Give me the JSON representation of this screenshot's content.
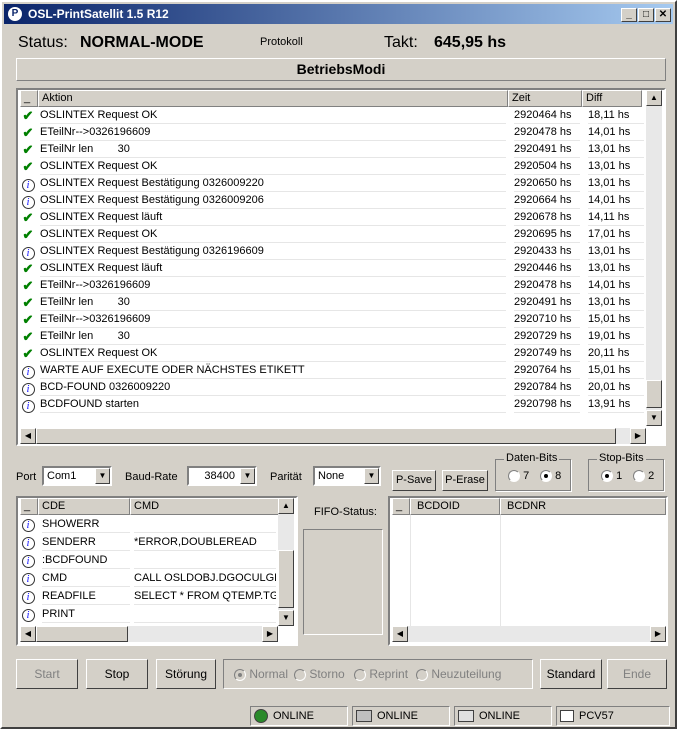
{
  "window": {
    "title": "OSL-PrintSatellit 1.5 R12",
    "app_icon": "P",
    "min": "_",
    "max": "□",
    "close": "✕"
  },
  "top": {
    "status_label": "Status:",
    "status_value": "NORMAL-MODE",
    "protokoll": "Protokoll",
    "takt_label": "Takt:",
    "takt_value": "645,95 hs"
  },
  "mode_title": "BetriebsModi",
  "log": {
    "headers": [
      "_",
      "Aktion",
      "Zeit",
      "Diff"
    ],
    "rows": [
      {
        "icon": "check",
        "aktion": "OSLINTEX Request OK",
        "zeit": "2920464 hs",
        "diff": "18,11 hs"
      },
      {
        "icon": "check",
        "aktion": "ETeilNr-->0326196609",
        "zeit": "2920478 hs",
        "diff": "14,01 hs"
      },
      {
        "icon": "check",
        "aktion": "ETeilNr len        30",
        "zeit": "2920491 hs",
        "diff": "13,01 hs"
      },
      {
        "icon": "check",
        "aktion": "OSLINTEX Request OK",
        "zeit": "2920504 hs",
        "diff": "13,01 hs"
      },
      {
        "icon": "info",
        "aktion": "OSLINTEX Request Bestätigung 0326009220",
        "zeit": "2920650 hs",
        "diff": "13,01 hs"
      },
      {
        "icon": "info",
        "aktion": "OSLINTEX Request Bestätigung 0326009206",
        "zeit": "2920664 hs",
        "diff": "14,01 hs"
      },
      {
        "icon": "check",
        "aktion": "OSLINTEX Request läuft",
        "zeit": "2920678 hs",
        "diff": "14,11 hs"
      },
      {
        "icon": "check",
        "aktion": "OSLINTEX Request OK",
        "zeit": "2920695 hs",
        "diff": "17,01 hs"
      },
      {
        "icon": "info",
        "aktion": "OSLINTEX Request Bestätigung 0326196609",
        "zeit": "2920433 hs",
        "diff": "13,01 hs"
      },
      {
        "icon": "check",
        "aktion": "OSLINTEX Request läuft",
        "zeit": "2920446 hs",
        "diff": "13,01 hs"
      },
      {
        "icon": "check",
        "aktion": "ETeilNr-->0326196609",
        "zeit": "2920478 hs",
        "diff": "14,01 hs"
      },
      {
        "icon": "check",
        "aktion": "ETeilNr len        30",
        "zeit": "2920491 hs",
        "diff": "13,01 hs"
      },
      {
        "icon": "check",
        "aktion": "ETeilNr-->0326196609",
        "zeit": "2920710 hs",
        "diff": "15,01 hs"
      },
      {
        "icon": "check",
        "aktion": "ETeilNr len        30",
        "zeit": "2920729 hs",
        "diff": "19,01 hs"
      },
      {
        "icon": "check",
        "aktion": "OSLINTEX Request OK",
        "zeit": "2920749 hs",
        "diff": "20,11 hs"
      },
      {
        "icon": "info",
        "aktion": "WARTE AUF EXECUTE ODER NÄCHSTES ETIKETT",
        "zeit": "2920764 hs",
        "diff": "15,01 hs"
      },
      {
        "icon": "info",
        "aktion": "BCD-FOUND 0326009220",
        "zeit": "2920784 hs",
        "diff": "20,01 hs"
      },
      {
        "icon": "info",
        "aktion": "BCDFOUND starten",
        "zeit": "2920798 hs",
        "diff": "13,91 hs"
      }
    ]
  },
  "port": {
    "label": "Port",
    "value": "Com1",
    "baud_label": "Baud-Rate",
    "baud_value": "38400",
    "paritaet_label": "Parität",
    "paritaet_value": "None"
  },
  "buttons": {
    "psave": "P-Save",
    "perase": "P-Erase",
    "start": "Start",
    "stop": "Stop",
    "stoerung": "Störung",
    "standard": "Standard",
    "ende": "Ende"
  },
  "databits": {
    "title": "Daten-Bits",
    "opt1": "7",
    "opt2": "8"
  },
  "stopbits": {
    "title": "Stop-Bits",
    "opt1": "1",
    "opt2": "2"
  },
  "cmd": {
    "headers": [
      "_",
      "CDE",
      "CMD"
    ],
    "rows": [
      {
        "cde": "SHOWERR",
        "cmd": ""
      },
      {
        "cde": "SENDERR",
        "cmd": "*ERROR,DOUBLEREAD"
      },
      {
        "cde": ":BCDFOUND",
        "cmd": ""
      },
      {
        "cde": "CMD",
        "cmd": "CALL OSLDOBJ.DGOCULGP"
      },
      {
        "cde": "READFILE",
        "cmd": "SELECT * FROM QTEMP.TGO"
      },
      {
        "cde": "PRINT",
        "cmd": ""
      }
    ]
  },
  "fifo": {
    "label": "FIFO-Status:"
  },
  "bcd": {
    "headers": [
      "_",
      "BCDOID",
      "BCDNR"
    ]
  },
  "modes": {
    "normal": "Normal",
    "storno": "Storno",
    "reprint": "Reprint",
    "neuzuteilung": "Neuzuteilung"
  },
  "statusbar": {
    "s1": "ONLINE",
    "s2": "ONLINE",
    "s3": "ONLINE",
    "s4": "PCV57"
  }
}
